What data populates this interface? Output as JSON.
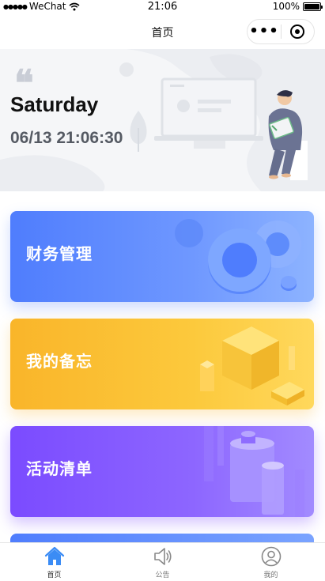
{
  "status_bar": {
    "carrier": "WeChat",
    "time": "21:06",
    "battery": "100%"
  },
  "navbar": {
    "title": "首页"
  },
  "hero": {
    "quote_mark": "❝",
    "day": "Saturday",
    "datetime": "06/13 21:06:30"
  },
  "cards": [
    {
      "label": "财务管理",
      "color": "#4f7dfd"
    },
    {
      "label": "我的备忘",
      "color": "#f9b52a"
    },
    {
      "label": "活动清单",
      "color": "#7b4bff"
    }
  ],
  "tabbar": {
    "tabs": [
      {
        "label": "首页",
        "icon": "home-icon",
        "active": true
      },
      {
        "label": "公告",
        "icon": "speaker-icon",
        "active": false
      },
      {
        "label": "我的",
        "icon": "user-icon",
        "active": false
      }
    ],
    "active_color": "#3b8cf5"
  }
}
